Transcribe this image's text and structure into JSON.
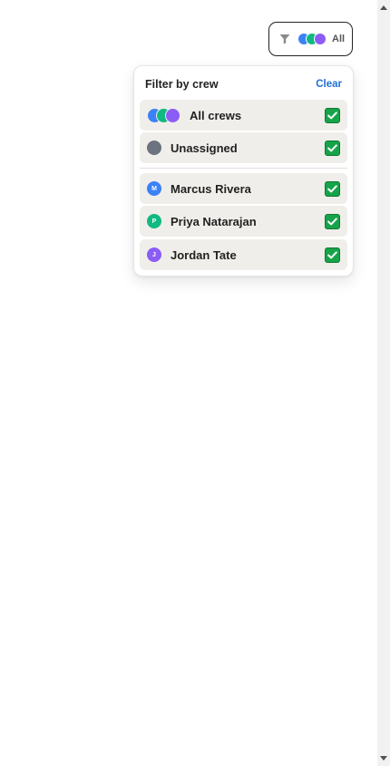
{
  "trigger": {
    "label": "All",
    "icon": "funnel-icon",
    "avatar_colors": [
      "#3b82f6",
      "#10b981",
      "#8b5cf6"
    ]
  },
  "panel": {
    "title": "Filter by crew",
    "clear_label": "Clear",
    "options": [
      {
        "label": "All crews",
        "checked": true
      },
      {
        "label": "Unassigned",
        "checked": true,
        "color": "#6b7280"
      }
    ],
    "crews": [
      {
        "initial": "M",
        "name": "Marcus Rivera",
        "color": "#3b82f6",
        "checked": true
      },
      {
        "initial": "P",
        "name": "Priya Natarajan",
        "color": "#10b981",
        "checked": true
      },
      {
        "initial": "J",
        "name": "Jordan Tate",
        "color": "#8b5cf6",
        "checked": true
      }
    ]
  },
  "colors": {
    "accent_link": "#1f6fd6",
    "check_green": "#16a34a",
    "row_bg": "#f0eeea"
  }
}
